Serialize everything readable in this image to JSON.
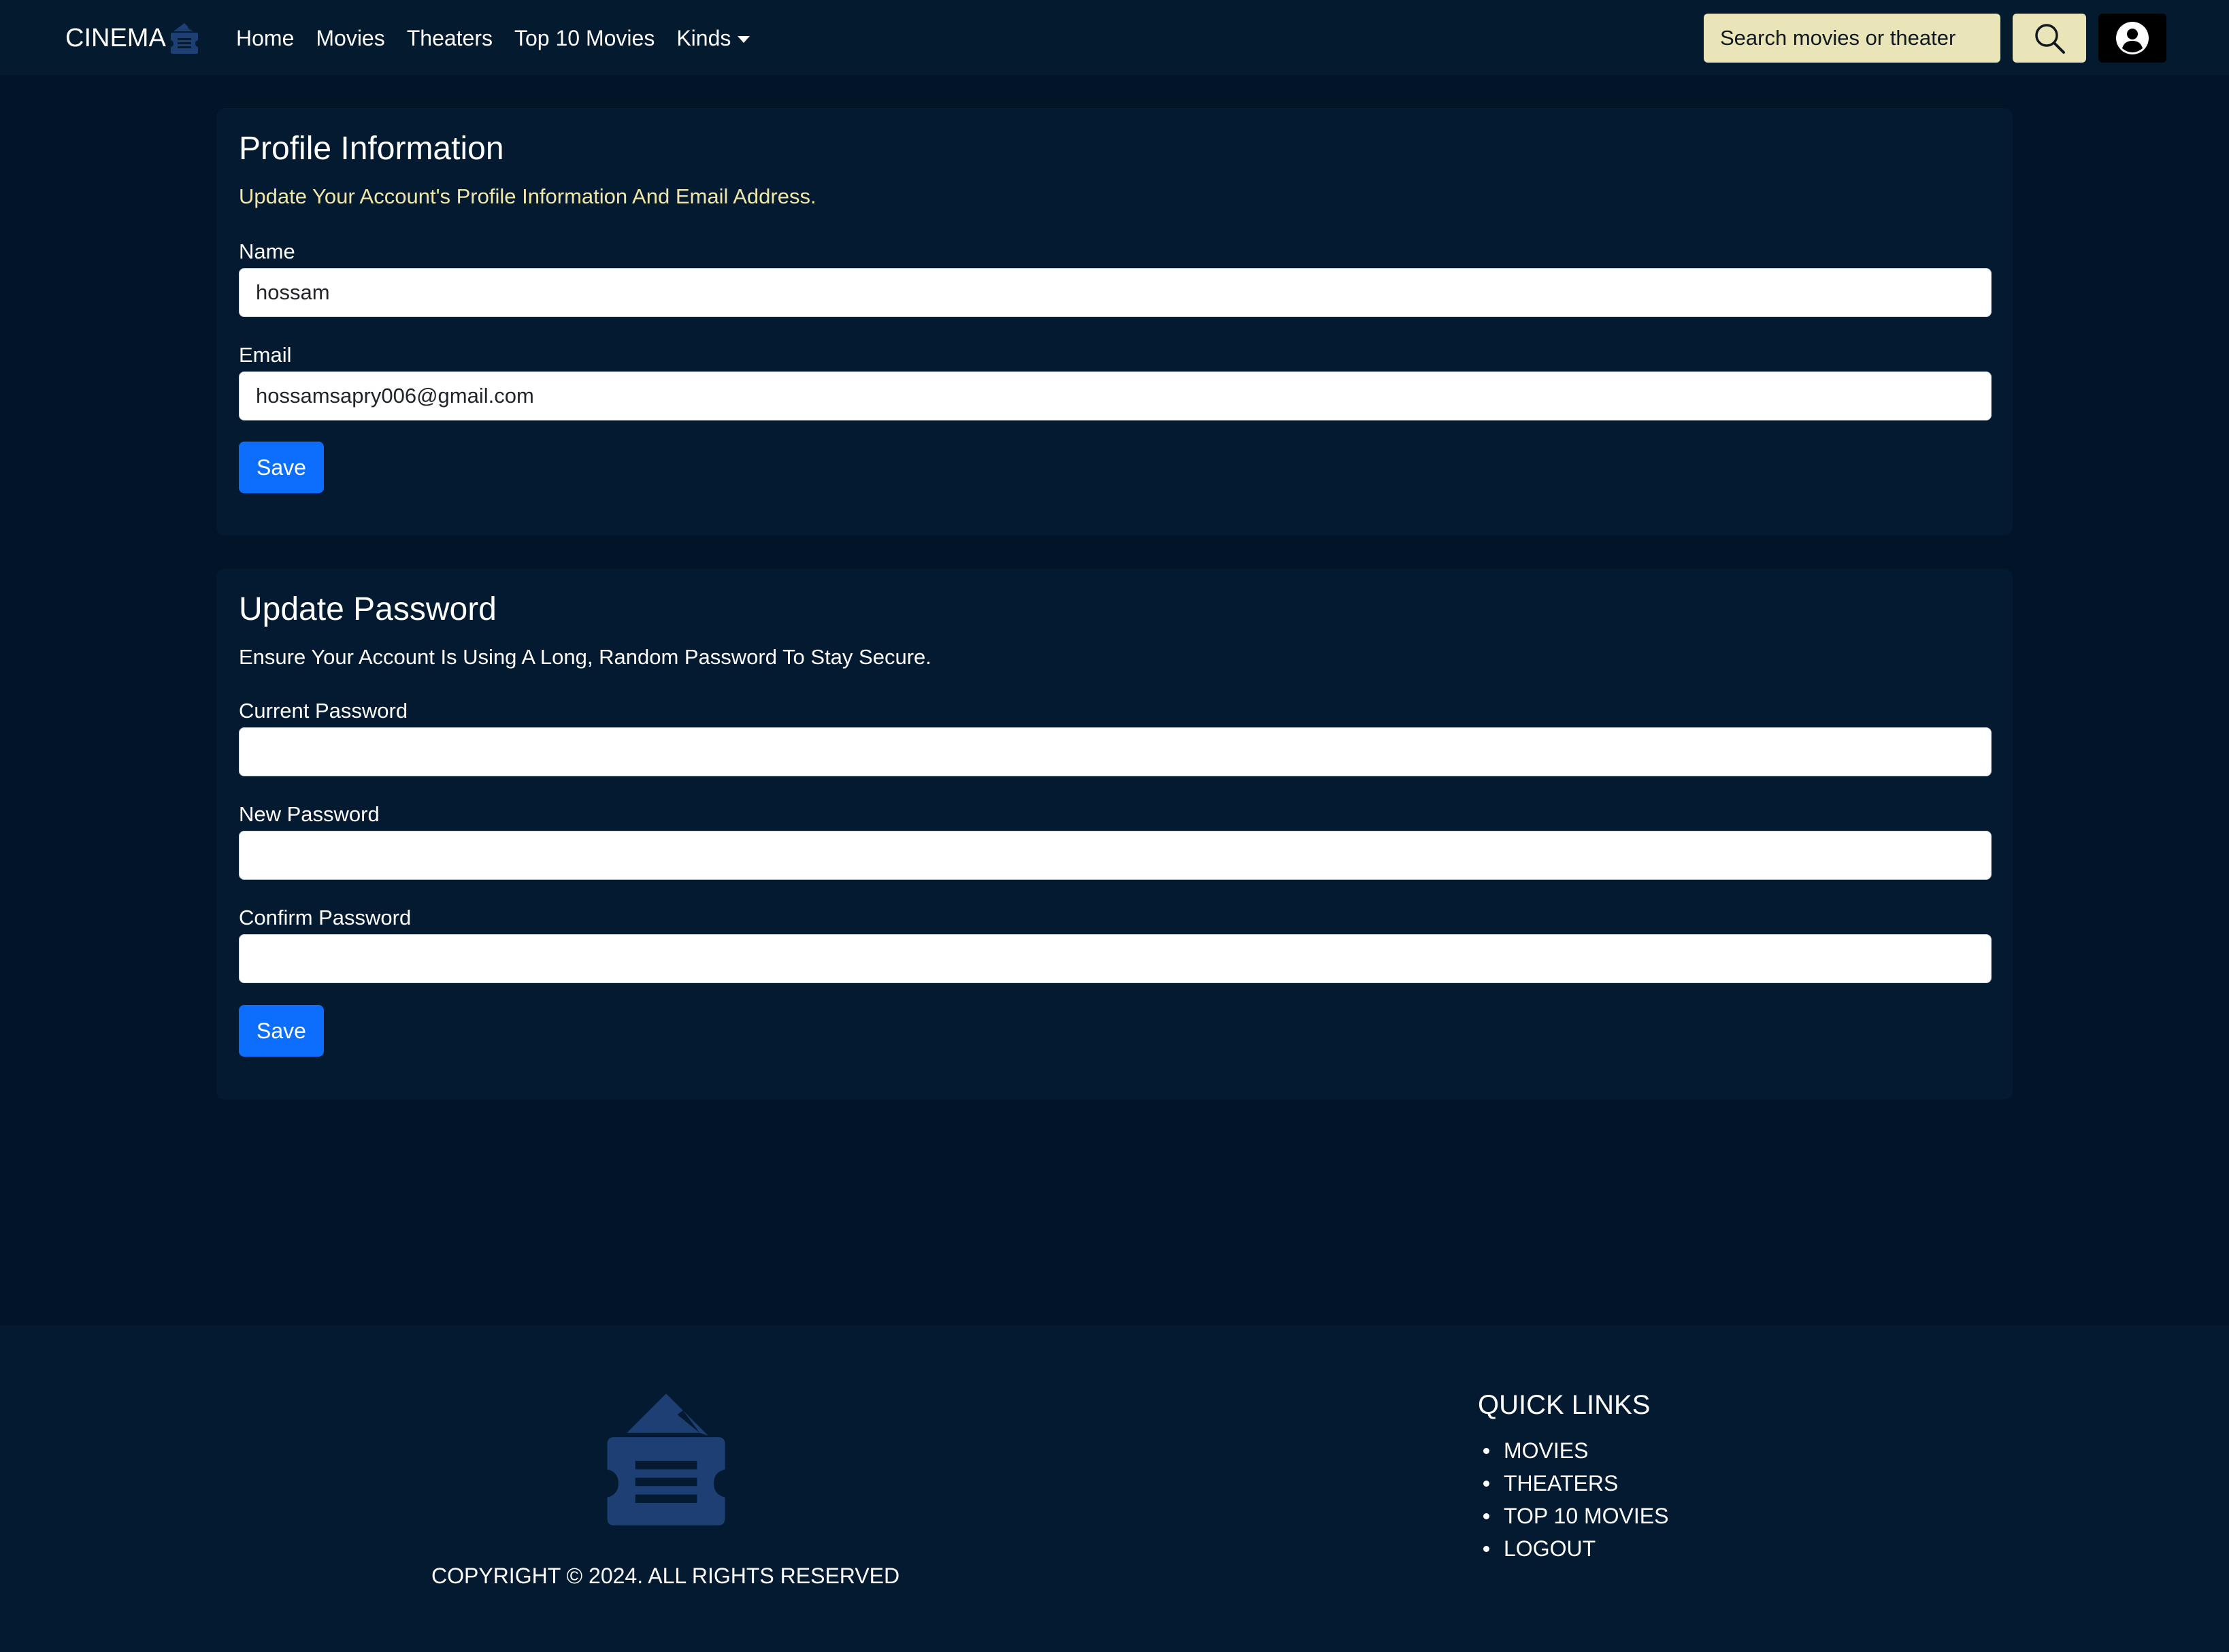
{
  "navbar": {
    "brand": "CINEMA",
    "links": [
      "Home",
      "Movies",
      "Theaters",
      "Top 10 Movies",
      "Kinds"
    ],
    "search_placeholder": "Search movies or theater",
    "search_icon": "search-icon",
    "user_icon": "user-circle-icon"
  },
  "profile": {
    "title": "Profile Information",
    "subtitle": "Update Your Account's Profile Information And Email Address.",
    "name_label": "Name",
    "name_value": "hossam",
    "email_label": "Email",
    "email_value": "hossamsapry006@gmail.com",
    "save_label": "Save"
  },
  "password": {
    "title": "Update Password",
    "subtitle": "Ensure Your Account Is Using A Long, Random Password To Stay Secure.",
    "current_label": "Current Password",
    "new_label": "New Password",
    "confirm_label": "Confirm Password",
    "save_label": "Save"
  },
  "footer": {
    "logo_icon": "cinema-ticket-icon",
    "copyright": "COPYRIGHT © 2024. ALL RIGHTS RESERVED",
    "quick_links_title": "QUICK LINKS",
    "quick_links": [
      "MOVIES",
      "THEATERS",
      "TOP 10 MOVIES",
      "LOGOUT"
    ]
  },
  "colors": {
    "page_bg": "#021427",
    "navbar_bg": "#031a2f",
    "card_bg": "#031a31",
    "accent_yellow": "#e9e5b9",
    "subtitle_yellow": "#f0e6a8",
    "primary_blue": "#0d6efd",
    "logo_blue": "#1d3f73"
  }
}
